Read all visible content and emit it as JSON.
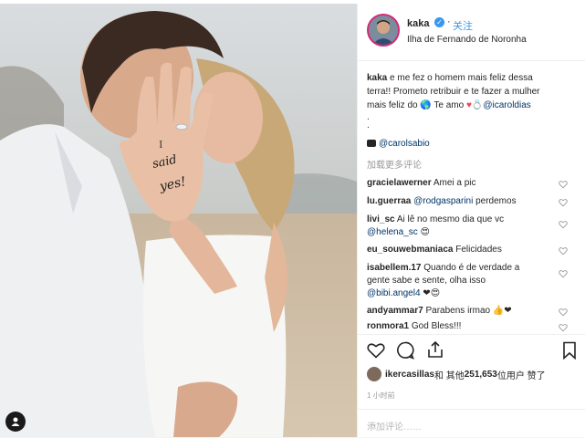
{
  "post": {
    "username": "kaka",
    "verified_mark": "✓",
    "follow_label": "关注",
    "location": "Ilha de Fernando de Noronha",
    "caption_user": "kaka",
    "caption_line1": " e me fez o homem mais feliz dessa",
    "caption_line2": "terra!! Prometo retribuir e te fazer a mulher",
    "caption_line3_pre": "mais feliz do ",
    "caption_line3_mid": " Te amo ",
    "caption_mention": "@icaroldias",
    "caption_dots": ".\n.",
    "photo_credit": "@carolsabio",
    "load_more": "加载更多评论",
    "hand_text_1": "I",
    "hand_text_2": "said",
    "hand_text_3": "yes!"
  },
  "comments": [
    {
      "user": "gracielawerner",
      "text": " Amei a pic"
    },
    {
      "user": "lu.guerraa",
      "mention": " @rodgasparini",
      "text": " perdemos"
    },
    {
      "user": "livi_sc",
      "text": " Ai lê no mesmo dia que vc",
      "line2_mention": "@helena_sc",
      "line2_text": " 😍"
    },
    {
      "user": "eu_souwebmaniaca",
      "text": " Felicidades"
    },
    {
      "user": "isabellem.17",
      "text": " Quando é de verdade a",
      "line2_text": "gente sabe e sente, olha isso",
      "line3_mention": "@bibi.angel4",
      "line3_text": " ❤😍"
    },
    {
      "user": "andyammar7",
      "text": " Parabens irmao 👍❤"
    },
    {
      "user": "ronmora1",
      "text": " God Bless!!!"
    }
  ],
  "likes": {
    "user": "ikercasillas",
    "middle": " 和 其他 ",
    "count": "251,653",
    "suffix": " 位用户 赞了"
  },
  "timestamp": "1 小时前",
  "add_comment_placeholder": "添加评论……",
  "more_label": "···",
  "colors": {
    "link": "#3897f0",
    "verified": "#3897f0",
    "heart": "#ed4956",
    "mention": "#003569"
  }
}
